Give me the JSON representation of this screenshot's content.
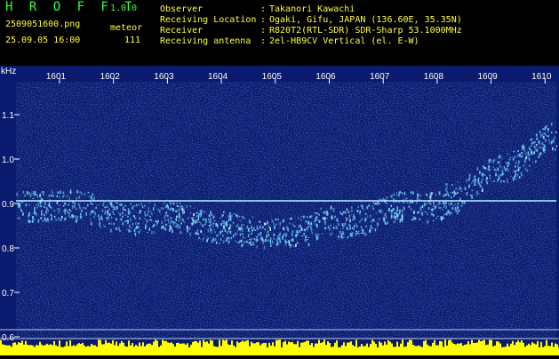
{
  "header": {
    "title": "H R O F F T",
    "version": "1.0.0",
    "filename": "2509051600.png",
    "meteor_label": "meteor",
    "datetime": "25.09.05 16:00",
    "meteor_count": "111",
    "info": [
      {
        "label": "Observer",
        "value": "Takanori Kawachi"
      },
      {
        "label": "Receiving Location",
        "value": "Ogaki, Gifu, JAPAN (136.60E, 35.35N)"
      },
      {
        "label": "Receiver",
        "value": "R820T2(RTL-SDR) SDR-Sharp 53.1000MHz"
      },
      {
        "label": "Receiving antenna",
        "value": "2el-HB9CV Vertical (el. E-W)"
      }
    ]
  },
  "spectrogram": {
    "unit_label": "kHz",
    "time_ticks": [
      "1601",
      "1602",
      "1603",
      "1604",
      "1605",
      "1606",
      "1607",
      "1608",
      "1609",
      "1610"
    ],
    "freq_ticks": [
      "1.1",
      "1.0",
      "0.9",
      "0.8",
      "0.7",
      "0.6"
    ],
    "colors": {
      "background": "#0a1a6e",
      "noise": "#2a5ad0",
      "trace": "#6fd3ff",
      "carrier": "#b8f4ff",
      "level_bars": "#ffff00",
      "axis": "#ffffff"
    }
  }
}
